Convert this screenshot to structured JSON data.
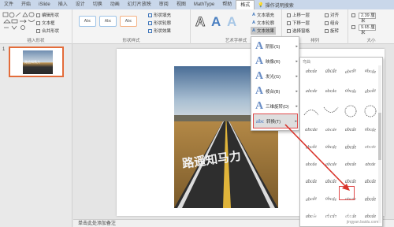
{
  "tabs": [
    {
      "label": "文件"
    },
    {
      "label": "开始"
    },
    {
      "label": "iSlide"
    },
    {
      "label": "插入"
    },
    {
      "label": "设计"
    },
    {
      "label": "切换"
    },
    {
      "label": "动画"
    },
    {
      "label": "幻灯片放映"
    },
    {
      "label": "审阅"
    },
    {
      "label": "视图"
    },
    {
      "label": "MathType"
    },
    {
      "label": "帮助"
    },
    {
      "label": "格式"
    }
  ],
  "tell_me": "操作说明搜索",
  "ribbon": {
    "insert_shapes_label": "插入形状",
    "edit_shape": "编辑形状",
    "text_box": "文本框",
    "merge_shapes": "合并形状",
    "shape_styles_label": "形状样式",
    "style_sample": "Abc",
    "shape_fill": "形状填充",
    "shape_outline": "形状轮廓",
    "shape_effects": "形状效果",
    "wordart_label": "艺术字样式",
    "text_fill": "文本填充",
    "text_outline": "文本轮廓",
    "text_effects": "文本效果",
    "arrange_label": "排列",
    "bring_forward": "上移一层",
    "send_backward": "下移一层",
    "selection_pane": "选择窗格",
    "align": "对齐",
    "group": "组合",
    "rotate": "旋转",
    "size_label": "大小",
    "height": "2.39 厘米",
    "width": "9.65 厘米"
  },
  "slide_number": "1",
  "thumb_text": "路追知馬力",
  "photo_text": "路遥知马力",
  "notes_placeholder": "单击此处添加备注",
  "effects_menu": [
    {
      "label": "阴影(S)",
      "icon": "A"
    },
    {
      "label": "映像(R)",
      "icon": "A"
    },
    {
      "label": "发光(G)",
      "icon": "A"
    },
    {
      "label": "棱台(B)",
      "icon": "A"
    },
    {
      "label": "三维旋转(D)",
      "icon": "A"
    },
    {
      "label": "转换(T)",
      "icon": "abc"
    }
  ],
  "transform_header": "弯曲",
  "transform_sample": "abcde",
  "watermark": "Baidu经验",
  "watermark_sub": "jingyan.baidu.com",
  "colors": {
    "accent": "#e36c3a",
    "ribbon_tab_bg": "#c9d7ea",
    "highlight": "#e04a4a",
    "arrow": "#d9342b"
  }
}
